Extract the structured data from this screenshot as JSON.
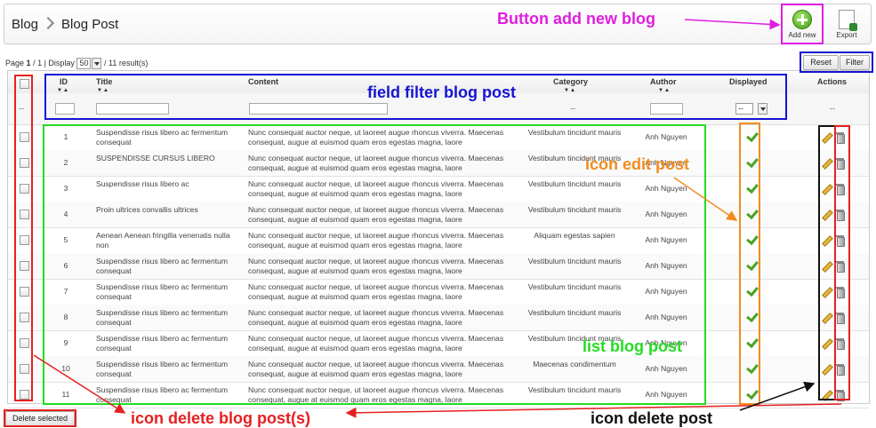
{
  "header": {
    "breadcrumb": [
      "Blog",
      "Blog Post"
    ],
    "add_label": "Add new",
    "export_label": "Export"
  },
  "pager": {
    "page_label": "Page",
    "page_current": "1",
    "page_total": "/ 1 | Display",
    "per_page": "50",
    "results": "/ 11 result(s)"
  },
  "filter_buttons": {
    "reset": "Reset",
    "filter": "Filter"
  },
  "columns": {
    "id": "ID",
    "title": "Title",
    "content": "Content",
    "category": "Category",
    "author": "Author",
    "displayed": "Displayed",
    "actions": "Actions",
    "sort_arrows": "▼▲"
  },
  "filters": {
    "dash": "--",
    "displayed_value": "--"
  },
  "rows": [
    {
      "id": "1",
      "title": "Suspendisse risus libero ac fermentum consequat",
      "content": "Nunc consequat auctor neque, ut laoreet augue rhoncus viverra. Maecenas consequat, augue at euismod quam eros egestas magna, laore",
      "category": "Vestibulum tincidunt mauris",
      "author": "Anh Nguyen"
    },
    {
      "id": "2",
      "title": "SUSPENDISSE CURSUS LIBERO",
      "content": "Nunc consequat auctor neque, ut laoreet augue rhoncus viverra. Maecenas consequat, augue at euismod quam eros egestas magna, laore",
      "category": "Vestibulum tincidunt mauris",
      "author": "Anh Nguyen"
    },
    {
      "id": "3",
      "title": "Suspendisse risus libero ac",
      "content": "Nunc consequat auctor neque, ut laoreet augue rhoncus viverra. Maecenas consequat, augue at euismod quam eros egestas magna, laore",
      "category": "Vestibulum tincidunt mauris",
      "author": "Anh Nguyen"
    },
    {
      "id": "4",
      "title": "Proin ultrices convallis ultrices",
      "content": "Nunc consequat auctor neque, ut laoreet augue rhoncus viverra. Maecenas consequat, augue at euismod quam eros egestas magna, laore",
      "category": "Vestibulum tincidunt mauris",
      "author": "Anh Nguyen"
    },
    {
      "id": "5",
      "title": "Aenean Aenean fringilla venenatis nulla non",
      "content": "Nunc consequat auctor neque, ut laoreet augue rhoncus viverra. Maecenas consequat, augue at euismod quam eros egestas magna, laore",
      "category": "Aliquam egestas sapien",
      "author": "Anh Nguyen"
    },
    {
      "id": "6",
      "title": "Suspendisse risus libero ac fermentum consequat",
      "content": "Nunc consequat auctor neque, ut laoreet augue rhoncus viverra. Maecenas consequat, augue at euismod quam eros egestas magna, laore",
      "category": "Vestibulum tincidunt mauris",
      "author": "Anh Nguyen"
    },
    {
      "id": "7",
      "title": "Suspendisse risus libero ac fermentum consequat",
      "content": "Nunc consequat auctor neque, ut laoreet augue rhoncus viverra. Maecenas consequat, augue at euismod quam eros egestas magna, laore",
      "category": "Vestibulum tincidunt mauris",
      "author": "Anh Nguyen"
    },
    {
      "id": "8",
      "title": "Suspendisse risus libero ac fermentum consequat",
      "content": "Nunc consequat auctor neque, ut laoreet augue rhoncus viverra. Maecenas consequat, augue at euismod quam eros egestas magna, laore",
      "category": "Vestibulum tincidunt mauris",
      "author": "Anh Nguyen"
    },
    {
      "id": "9",
      "title": "Suspendisse risus libero ac fermentum consequat",
      "content": "Nunc consequat auctor neque, ut laoreet augue rhoncus viverra. Maecenas consequat, augue at euismod quam eros egestas magna, laore",
      "category": "Vestibulum tincidunt mauris",
      "author": "Anh Nguyen"
    },
    {
      "id": "10",
      "title": "Suspendisse risus libero ac fermentum consequat",
      "content": "Nunc consequat auctor neque, ut laoreet augue rhoncus viverra. Maecenas consequat, augue at euismod quam eros egestas magna, laore",
      "category": "Maecenas condimentum",
      "author": "Anh Nguyen"
    },
    {
      "id": "11",
      "title": "Suspendisse risus libero ac fermentum consequat",
      "content": "Nunc consequat auctor neque, ut laoreet augue rhoncus viverra. Maecenas consequat, augue at euismod quam eros egestas magna, laore",
      "category": "Vestibulum tincidunt mauris",
      "author": "Anh Nguyen"
    }
  ],
  "delete_selected": "Delete selected",
  "annotations": {
    "add_blog": "Button add new blog",
    "field_filter": "field filter blog post",
    "edit_post": "icon edit post",
    "list_post": "list blog post",
    "delete_posts": "icon delete blog post(s)",
    "delete_post": "icon delete post"
  },
  "colors": {
    "magenta": "#e01ee0",
    "blue": "#1414d2",
    "orange": "#f08c1e",
    "green": "#22dd22",
    "red": "#e62020",
    "black": "#111111"
  },
  "icons": {
    "add": "plus-circle-icon",
    "export": "export-icon",
    "edit": "pencil-icon",
    "delete": "trash-icon",
    "displayed": "check-icon",
    "breadcrumb_sep": "chevron-right-icon"
  }
}
